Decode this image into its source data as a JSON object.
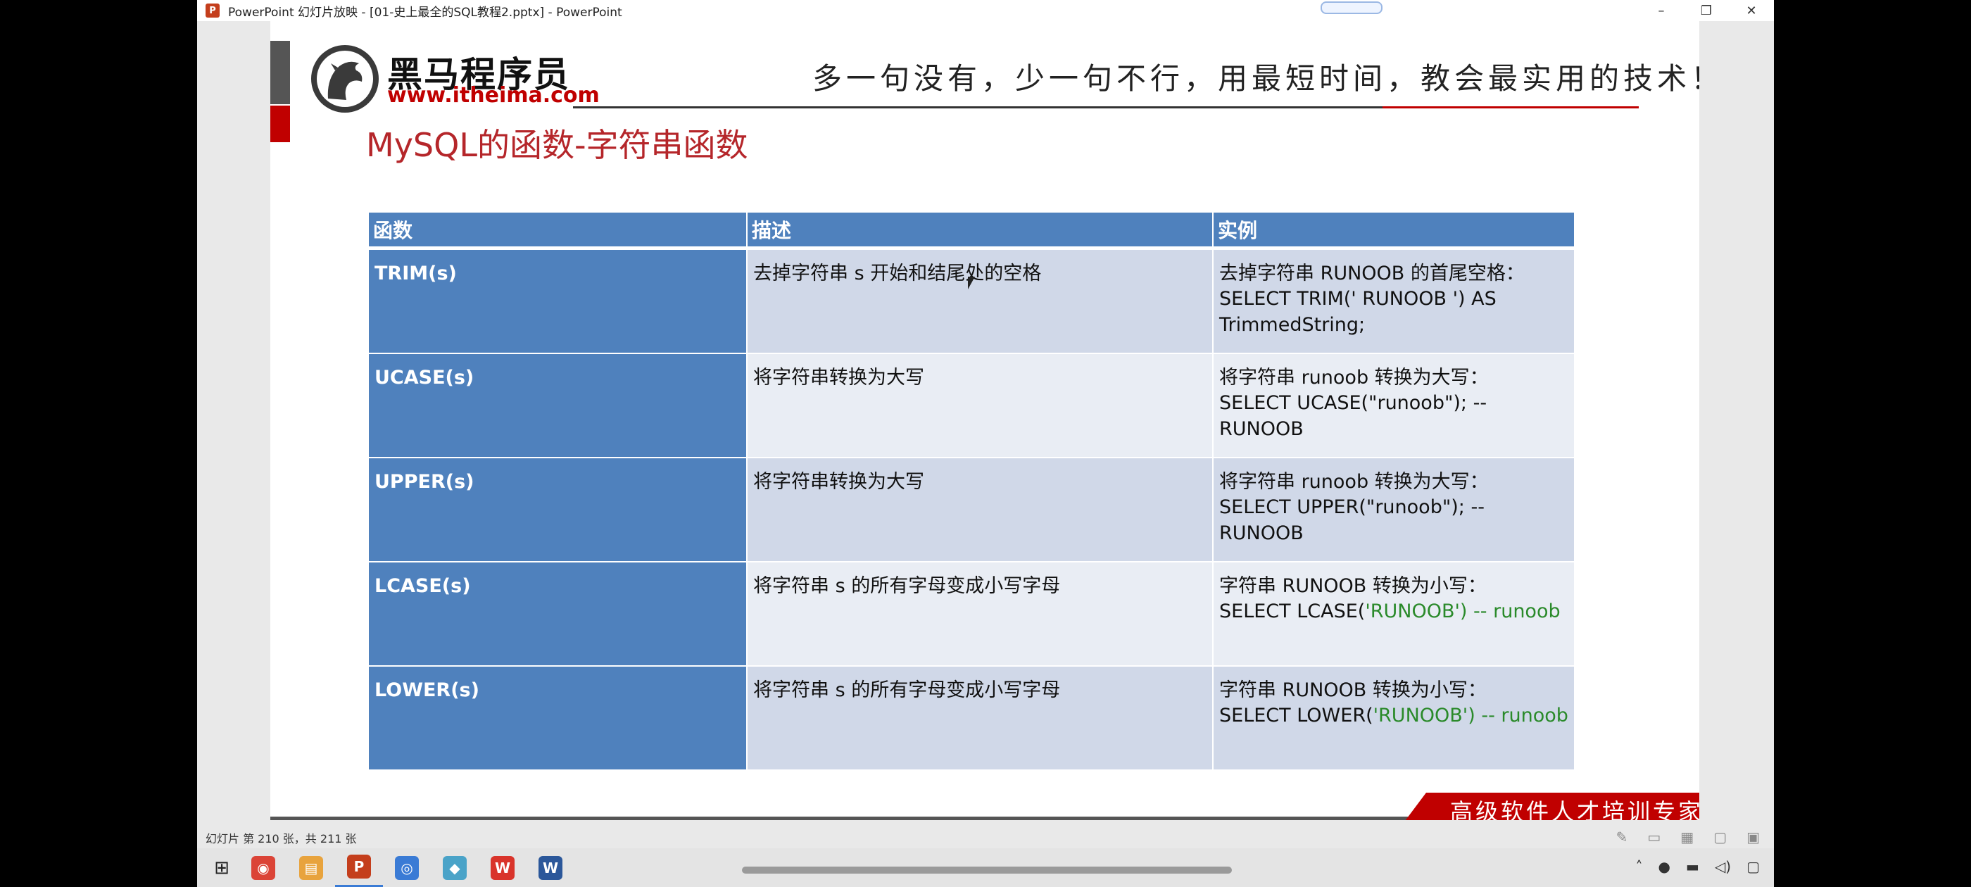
{
  "window": {
    "title": "PowerPoint 幻灯片放映 - [01-史上最全的SQL教程2.pptx] - PowerPoint",
    "app_icon": "P",
    "controls": {
      "minimize": "–",
      "restore": "❐",
      "close": "✕"
    }
  },
  "slide": {
    "brand_name": "黑马程序员",
    "brand_url": "www.itheima.com",
    "slogan": "多一句没有，少一句不行，用最短时间，教会最实用的技术！",
    "title": "MySQL的函数-字符串函数",
    "footer_tagline": "高级软件人才培训专家",
    "table": {
      "headers": [
        "函数",
        "描述",
        "实例"
      ],
      "rows": [
        {
          "name": "TRIM(s)",
          "desc": "去掉字符串 s 开始和结尾处的空格",
          "ex1": "去掉字符串 RUNOOB 的首尾空格：",
          "ex2": "SELECT TRIM('    RUNOOB    ') AS TrimmedString;"
        },
        {
          "name": "UCASE(s)",
          "desc": "将字符串转换为大写",
          "ex1": "将字符串 runoob 转换为大写：",
          "ex2": "SELECT UCASE(\"runoob\"); -- RUNOOB"
        },
        {
          "name": "UPPER(s)",
          "desc": "将字符串转换为大写",
          "ex1": "将字符串 runoob 转换为大写：",
          "ex2": "SELECT UPPER(\"runoob\"); -- RUNOOB"
        },
        {
          "name": "LCASE(s)",
          "desc": "将字符串 s 的所有字母变成小写字母",
          "ex1": "字符串 RUNOOB 转换为小写：",
          "ex2a": "SELECT LCASE(",
          "ex2b": "'RUNOOB')",
          "ex2c": " -- runoob"
        },
        {
          "name": "LOWER(s)",
          "desc": "将字符串 s 的所有字母变成小写字母",
          "ex1": "字符串 RUNOOB 转换为小写：",
          "ex2a": "SELECT LOWER(",
          "ex2b": "'RUNOOB')",
          "ex2c": " -- runoob"
        }
      ]
    }
  },
  "statusbar": {
    "text": "幻灯片 第 210 张，共 211 张"
  },
  "taskbar": {
    "apps": [
      {
        "name": "chrome",
        "glyph": "◉",
        "color": "#db4437"
      },
      {
        "name": "file-explorer",
        "glyph": "▤",
        "color": "#e8a33d"
      },
      {
        "name": "powerpoint",
        "glyph": "P",
        "color": "#c43e1c"
      },
      {
        "name": "app-4",
        "glyph": "◎",
        "color": "#3a7bd5"
      },
      {
        "name": "app-5",
        "glyph": "◆",
        "color": "#4aa3c8"
      },
      {
        "name": "wps",
        "glyph": "W",
        "color": "#d9342b"
      },
      {
        "name": "word",
        "glyph": "W",
        "color": "#2b579a"
      }
    ]
  }
}
